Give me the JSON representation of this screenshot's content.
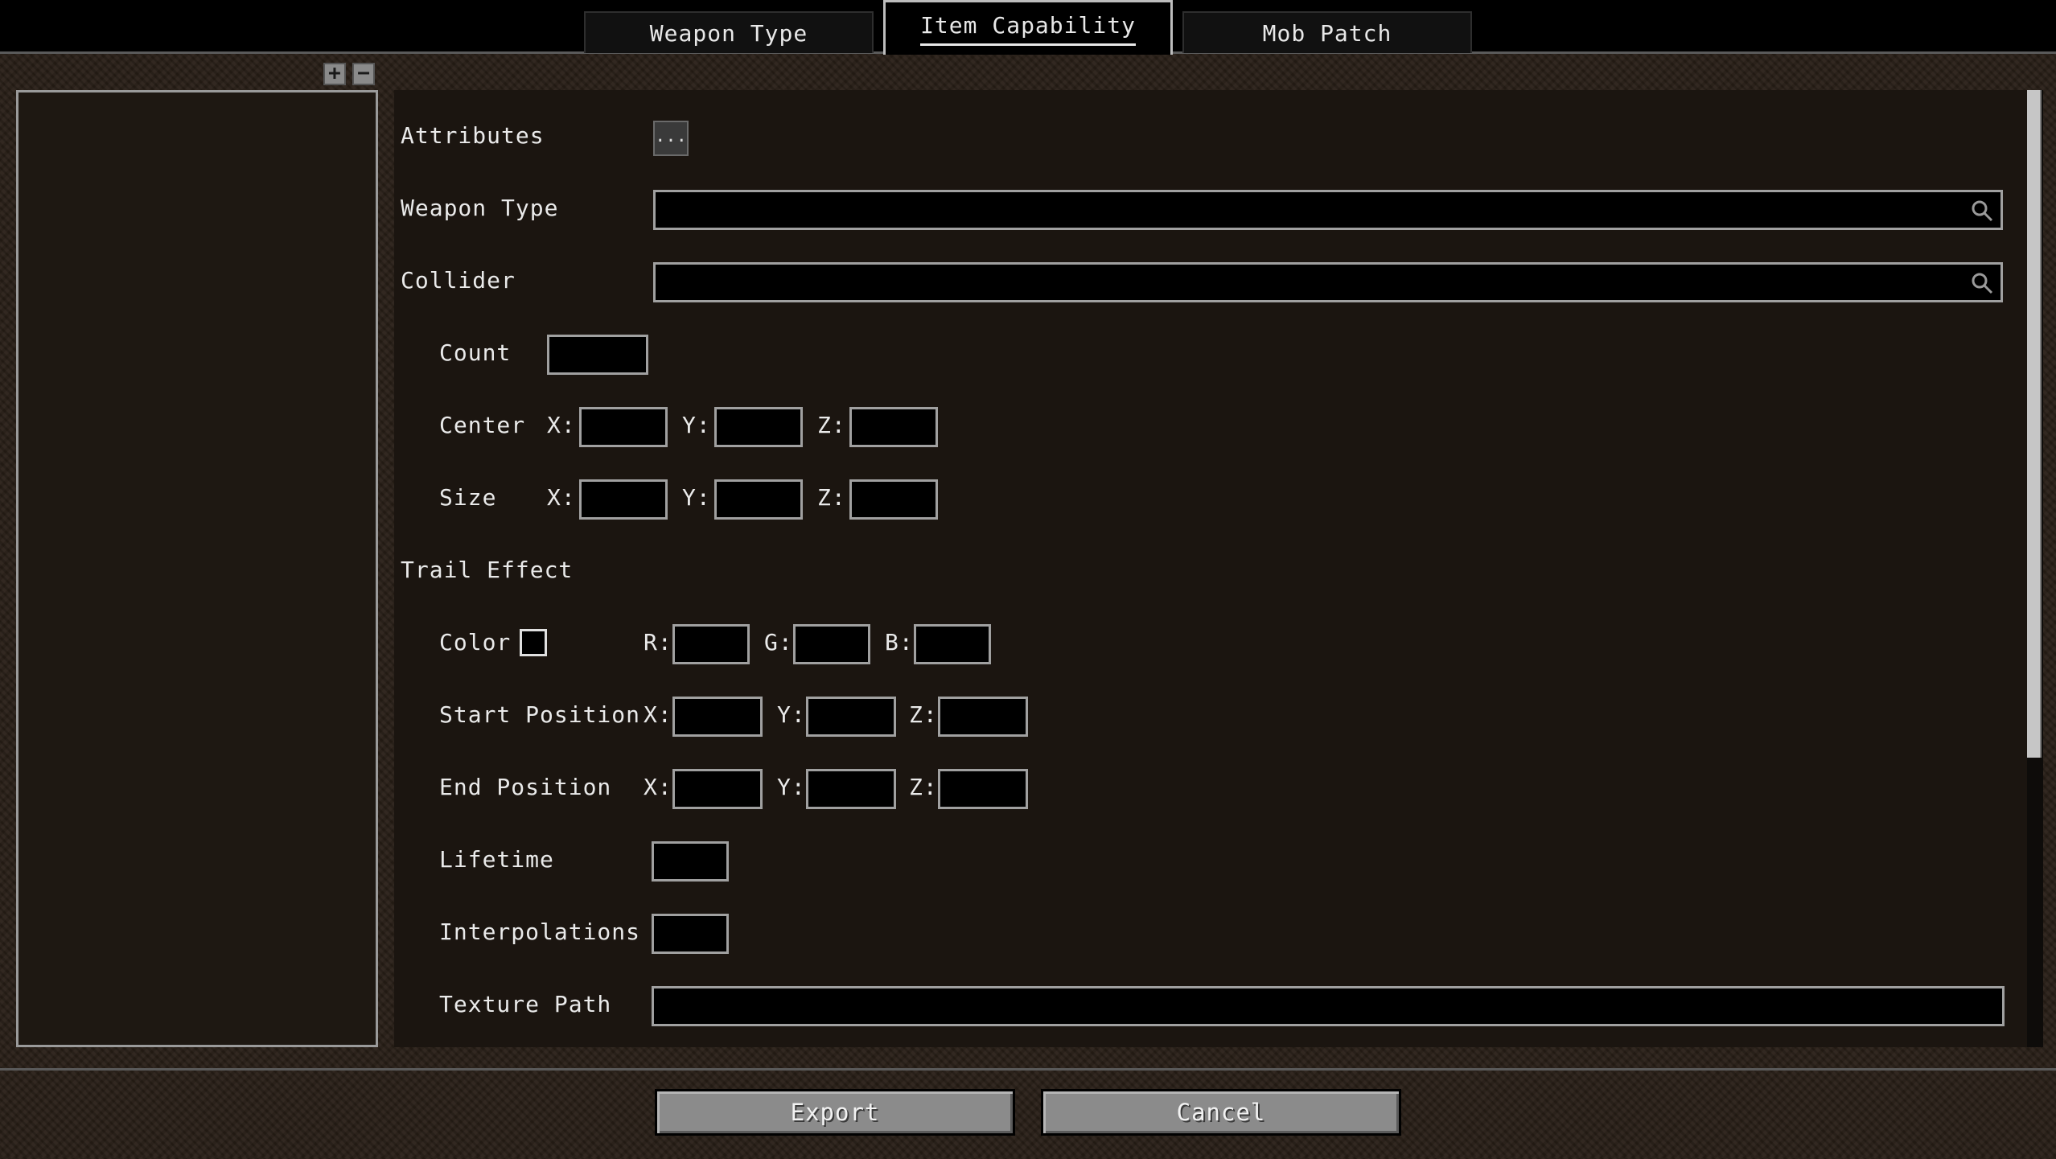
{
  "tabs": [
    {
      "label": "Weapon Type",
      "active": false
    },
    {
      "label": "Item Capability",
      "active": true
    },
    {
      "label": "Mob Patch",
      "active": false
    }
  ],
  "left_panel": {
    "add_label": "+",
    "remove_label": "−"
  },
  "form": {
    "attributes": {
      "label": "Attributes",
      "button_label": "..."
    },
    "weapon_type": {
      "label": "Weapon Type",
      "value": "",
      "icon": "search-icon"
    },
    "collider": {
      "label": "Collider",
      "value": "",
      "icon": "search-icon"
    },
    "count": {
      "label": "Count",
      "value": ""
    },
    "center": {
      "label": "Center",
      "x_label": "X:",
      "y_label": "Y:",
      "z_label": "Z:",
      "x": "",
      "y": "",
      "z": ""
    },
    "size": {
      "label": "Size",
      "x_label": "X:",
      "y_label": "Y:",
      "z_label": "Z:",
      "x": "",
      "y": "",
      "z": ""
    },
    "trail_effect": {
      "label": "Trail Effect"
    },
    "color": {
      "label": "Color",
      "r_label": "R:",
      "g_label": "G:",
      "b_label": "B:",
      "r": "",
      "g": "",
      "b": ""
    },
    "start_position": {
      "label": "Start Position",
      "x_label": "X:",
      "y_label": "Y:",
      "z_label": "Z:",
      "x": "",
      "y": "",
      "z": ""
    },
    "end_position": {
      "label": "End Position",
      "x_label": "X:",
      "y_label": "Y:",
      "z_label": "Z:",
      "x": "",
      "y": "",
      "z": ""
    },
    "lifetime": {
      "label": "Lifetime",
      "value": ""
    },
    "interpolations": {
      "label": "Interpolations",
      "value": ""
    },
    "texture_path": {
      "label": "Texture Path",
      "value": ""
    }
  },
  "buttons": {
    "export": "Export",
    "cancel": "Cancel"
  },
  "colors": {
    "background": "#2b2119",
    "panel": "#1b1510",
    "field_border": "#a0a0a0",
    "button": "#8b8b8b"
  }
}
